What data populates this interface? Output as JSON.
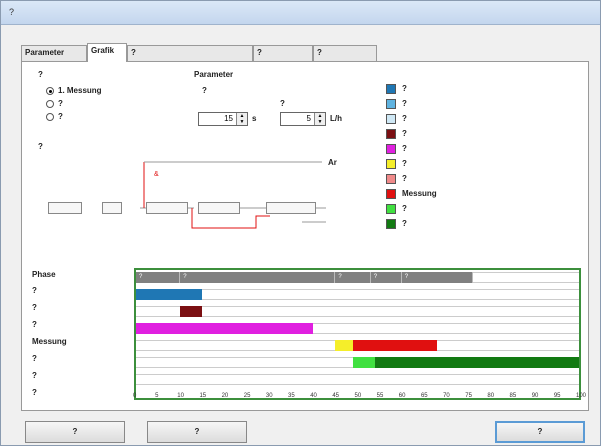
{
  "window": {
    "title": "?"
  },
  "tabs": [
    {
      "label": "Parameter"
    },
    {
      "label": "Grafik"
    },
    {
      "label": "?"
    },
    {
      "label": "?"
    },
    {
      "label": "?"
    }
  ],
  "grafik_fuer": {
    "heading": "?",
    "options": [
      {
        "label": "1. Messung",
        "selected": true
      },
      {
        "label": "?",
        "selected": false
      },
      {
        "label": "?",
        "selected": false
      }
    ]
  },
  "parameter": {
    "heading": "Parameter",
    "spuelzeit_label": "?",
    "spuelzeit_value": "15",
    "spuelzeit_unit": "s",
    "gasfluss_label": "?",
    "gasfluss_value": "5",
    "gasfluss_unit": "L/h"
  },
  "diagram": {
    "heading": "?",
    "ar_label": "Ar"
  },
  "legend": [
    {
      "label": "?",
      "color": "#1f77b4"
    },
    {
      "label": "?",
      "color": "#5fb3e0"
    },
    {
      "label": "?",
      "color": "#cfe8f5"
    },
    {
      "label": "?",
      "color": "#7b0f12"
    },
    {
      "label": "?",
      "color": "#e020e0"
    },
    {
      "label": "?",
      "color": "#f5ee2a"
    },
    {
      "label": "?",
      "color": "#f08a8a"
    },
    {
      "label": "Messung",
      "color": "#e01010"
    },
    {
      "label": "?",
      "color": "#40e040"
    },
    {
      "label": "?",
      "color": "#127a12"
    }
  ],
  "rows": [
    {
      "label": "Phase"
    },
    {
      "label": "?"
    },
    {
      "label": "?"
    },
    {
      "label": "?"
    },
    {
      "label": "Messung"
    },
    {
      "label": "?"
    },
    {
      "label": "?"
    }
  ],
  "time_label": "?",
  "chart_data": {
    "type": "gantt",
    "x_range": [
      0,
      100
    ],
    "x_ticks": [
      "0",
      "5",
      "10",
      "15",
      "20",
      "25",
      "30",
      "35",
      "40",
      "45",
      "50",
      "55",
      "60",
      "65",
      "70",
      "75",
      "80",
      "85",
      "90",
      "95",
      "100"
    ],
    "phases": [
      {
        "label": "?",
        "start": 0,
        "end": 10,
        "color": "#808080"
      },
      {
        "label": "?",
        "start": 10,
        "end": 45,
        "color": "#808080"
      },
      {
        "label": "?",
        "start": 45,
        "end": 53,
        "color": "#808080"
      },
      {
        "label": "?",
        "start": 53,
        "end": 60,
        "color": "#808080"
      },
      {
        "label": "?",
        "start": 60,
        "end": 76,
        "color": "#808080"
      }
    ],
    "bars": [
      {
        "row": 1,
        "start": 0,
        "end": 15,
        "color": "#1f77b4"
      },
      {
        "row": 2,
        "start": 10,
        "end": 15,
        "color": "#7b0f12"
      },
      {
        "row": 3,
        "start": 0,
        "end": 40,
        "color": "#e020e0"
      },
      {
        "row": 4,
        "start": 45,
        "end": 49,
        "color": "#f5ee2a"
      },
      {
        "row": 4,
        "start": 49,
        "end": 68,
        "color": "#e01010"
      },
      {
        "row": 5,
        "start": 49,
        "end": 54,
        "color": "#40e040"
      },
      {
        "row": 5,
        "start": 54,
        "end": 100,
        "color": "#127a12"
      }
    ]
  },
  "buttons": {
    "load": "?",
    "save": "?",
    "close": "?"
  }
}
